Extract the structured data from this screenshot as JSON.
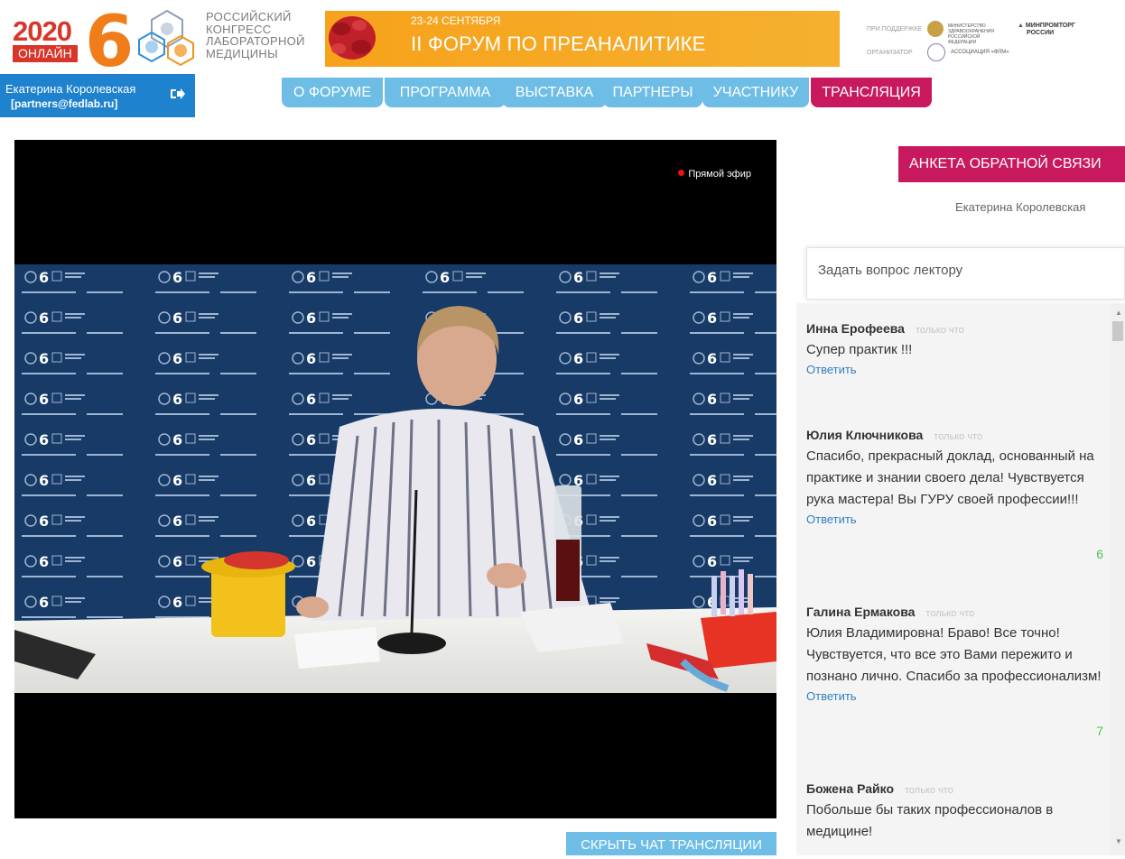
{
  "banner": {
    "year": "2020",
    "online": "ОНЛАЙН",
    "number": "6",
    "congress_lines": [
      "РОССИЙСКИЙ",
      "КОНГРЕСС",
      "ЛАБОРАТОРНОЙ",
      "МЕДИЦИНЫ"
    ],
    "dates": "23-24 СЕНТЯБРЯ",
    "forum_title": "II ФОРУМ ПО ПРЕАНАЛИТИКЕ",
    "support_label": "ПРИ ПОДДЕРЖКЕ",
    "organizer_label": "ОРГАНИЗАТОР",
    "ministry": "МИНИСТЕРСТВО ЗДРАВООХРАНЕНИЯ РОССИЙСКОЙ ФЕДЕРАЦИИ",
    "minprom_lines": [
      "МИНПРОМТОРГ",
      "РОССИИ"
    ],
    "association": "АССОЦИАЦИЯ «ФЛМ»"
  },
  "user": {
    "name": "Екатерина Королевская",
    "email": "[partners@fedlab.ru]"
  },
  "nav": {
    "items": [
      "О ФОРУМЕ",
      "ПРОГРАММА",
      "ВЫСТАВКА",
      "ПАРТНЕРЫ",
      "УЧАСТНИКУ",
      "ТРАНСЛЯЦИЯ"
    ],
    "active": "ТРАНСЛЯЦИЯ"
  },
  "video": {
    "live_label": "Прямой эфир",
    "backdrop_text": "II ФОРУМ ПО ПРЕАНАЛИТИКЕ"
  },
  "hide_chat_label": "СКРЫТЬ ЧАТ ТРАНСЛЯЦИИ",
  "feedback_label": "АНКЕТА ОБРАТНОЙ СВЯЗИ",
  "panel_user": "Екатерина Королевская",
  "question_placeholder": "Задать вопрос лектору",
  "chat": {
    "reply_label": "Ответить",
    "messages": [
      {
        "author": "Инна Ерофеева",
        "time": "только что",
        "text": "Супер практик !!!",
        "likes": ""
      },
      {
        "author": "Юлия Ключникова",
        "time": "только что",
        "text": "Спасибо,  прекрасный доклад, основанный на практике и знании своего дела! Чувствуется рука мастера! Вы ГУРУ своей профессии!!!",
        "likes": "6"
      },
      {
        "author": "Галина Ермакова",
        "time": "только что",
        "text": "Юлия Владимировна! Браво! Все точно! Чувствуется, что все это Вами пережито и познано лично. Спасибо за профессионализм!",
        "likes": "7"
      },
      {
        "author": "Божена Райко",
        "time": "только что",
        "text": "Побольше бы таких профессионалов в медицине!",
        "likes": ""
      }
    ]
  },
  "colors": {
    "brand_blue": "#1f82cf",
    "nav_blue": "#6dbde6",
    "accent_magenta": "#c8195f",
    "banner_orange": "#f7a21b",
    "likes_green": "#4fc24f"
  }
}
